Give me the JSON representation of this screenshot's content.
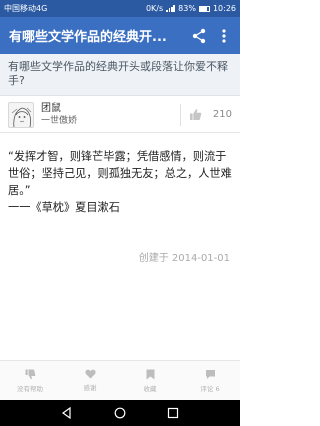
{
  "status_bar": {
    "carrier": "中国移动4G",
    "speed": "0K/s",
    "battery": "83%",
    "time": "10:26"
  },
  "app_bar": {
    "title": "有哪些文学作品的经典开..."
  },
  "question": {
    "text": "有哪些文学作品的经典开头或段落让你爱不释手?"
  },
  "author": {
    "name": "团鼠",
    "bio": "一世傲娇",
    "votes": "210"
  },
  "answer": {
    "text": "“发挥才智，则锋芒毕露；凭借感情，则流于世俗；坚持己见，则孤独无友；总之，人世难居。”\n一一《草枕》夏目漱石"
  },
  "created": "创建于 2014-01-01",
  "bottom_bar": {
    "items": [
      {
        "label": "没有帮助",
        "icon": "thumbs-down-icon"
      },
      {
        "label": "感谢",
        "icon": "heart-icon"
      },
      {
        "label": "收藏",
        "icon": "bookmark-icon"
      },
      {
        "label": "评论 6",
        "icon": "comment-icon"
      }
    ]
  },
  "colors": {
    "status_bar": "#2b5aa3",
    "app_bar": "#3b6fc1",
    "question_bg": "#eef2f6"
  }
}
